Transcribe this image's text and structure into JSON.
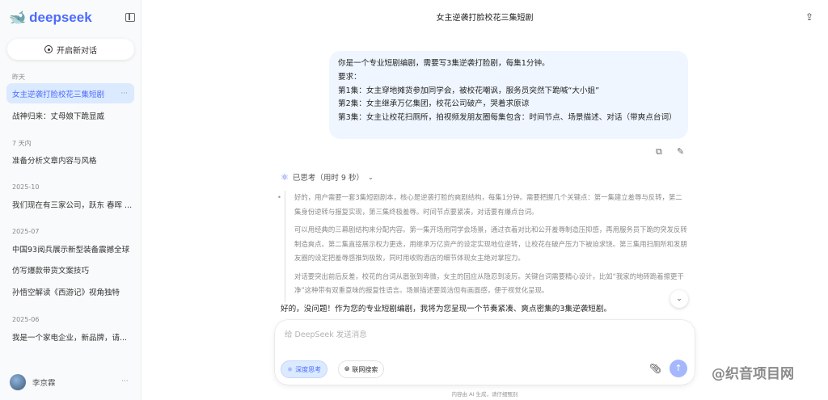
{
  "sidebar": {
    "logo": "deepseek",
    "new_chat": "开启新对话",
    "groups": [
      {
        "label": "昨天",
        "items": [
          "女主逆袭打脸校花三集短剧",
          "战神归来：丈母娘下跪显威"
        ]
      },
      {
        "label": "7 天内",
        "items": [
          "准备分析文章内容与风格"
        ]
      },
      {
        "label": "2025-10",
        "items": [
          "我们现在有三家公司，跃东 春晖 ..."
        ]
      },
      {
        "label": "2025-07",
        "items": [
          "中国93阅兵展示新型装备震撼全球",
          "仿写爆款带货文案技巧",
          "孙悟空解读《西游记》视角独特"
        ]
      },
      {
        "label": "2025-06",
        "items": [
          "我是一个家电企业，新品牌，请..."
        ]
      }
    ],
    "user": "李京霖"
  },
  "header": {
    "title": "女主逆袭打脸校花三集短剧"
  },
  "message": {
    "lines": [
      "你是一个专业短剧编剧，需要写3集逆袭打脸剧，每集1分钟。",
      "要求：",
      "第1集：女主穿地摊货参加同学会，被校花嘲讽，服务员突然下跪喊“大小姐”",
      "第2集：女主继承万亿集团，校花公司破产，哭着求原谅",
      "第3集：女主让校花扫厕所，拍视频发朋友圈每集包含：时间节点、场景描述、对话（带爽点台词）"
    ]
  },
  "thinking": {
    "header": "已思考（用时 9 秒）",
    "paragraphs": [
      "好的，用户需要一套3集短剧剧本，核心是逆袭打脸的爽剧结构，每集1分钟。需要把握几个关键点：第一集建立羞辱与反转，第二集身份逆转与报复实现，第三集终极羞辱。时间节点要紧凑，对话要有爆点台词。",
      "可以用经典的三幕剧结构来分配内容。第一集开场用同学会场景，通过衣着对比和公开羞辱制造压抑感，再用服务员下跪的突发反转制造爽点。第二集直接展示权力更迭，用继承万亿资产的设定实现地位逆转，让校花在破产压力下被迫求饶。第三集用扫厕所和发朋友圈的设定把羞辱感推到极致，同时用收购酒店的细节体现女主绝对掌控力。",
      "对话要突出前后反差，校花的台词从嚣张到卑微，女主的回应从隐忍到凌厉。关键台词需要精心设计，比如“我家的地砖跪着擦更干净”这种带有双重意味的报复性语言。场景描述要简洁但有画面感，便于视觉化呈现。"
    ]
  },
  "answer": "好的，没问题！作为您的专业短剧编剧，我将为您呈现一个节奏紧凑、爽点密集的3集逆袭短剧。",
  "input": {
    "placeholder": "给 DeepSeek 发送消息",
    "deep_think": "深度思考",
    "web_search": "联网搜索"
  },
  "footer_note": "内容由 AI 生成，请仔细甄别",
  "watermark": "@织音项目网",
  "colors": {
    "accent": "#4d6bfe",
    "bubble": "#eff6ff",
    "active_item": "#dbeafe"
  }
}
